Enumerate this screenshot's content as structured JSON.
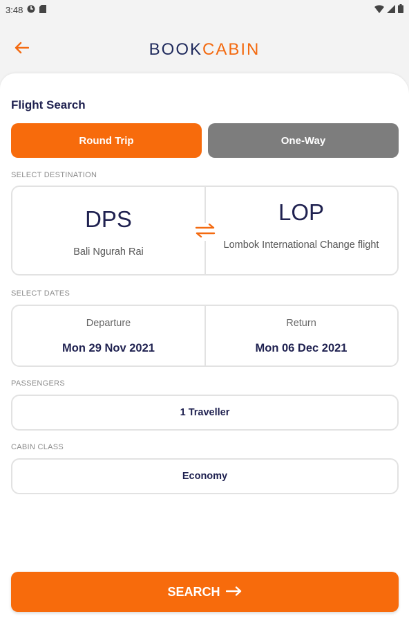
{
  "status_bar": {
    "time": "3:48"
  },
  "header": {
    "logo_part1": "BOOK",
    "logo_part2": "CABIN"
  },
  "colors": {
    "accent": "#f76b0c",
    "navy": "#1f2150",
    "inactive": "#7d7d7d"
  },
  "search": {
    "title": "Flight Search",
    "trip_types": [
      {
        "label": "Round Trip",
        "selected": true
      },
      {
        "label": "One-Way",
        "selected": false
      }
    ],
    "destination": {
      "section_label": "SELECT DESTINATION",
      "from_code": "DPS",
      "from_name": "Bali Ngurah Rai",
      "to_code": "LOP",
      "to_name": "Lombok International Change flight"
    },
    "dates": {
      "section_label": "SELECT DATES",
      "departure_caption": "Departure",
      "departure_value": "Mon 29 Nov 2021",
      "return_caption": "Return",
      "return_value": "Mon 06 Dec 2021"
    },
    "passengers": {
      "section_label": "PASSENGERS",
      "value": "1 Traveller"
    },
    "cabin_class": {
      "section_label": "CABIN CLASS",
      "value": "Economy"
    },
    "search_button": "SEARCH"
  }
}
